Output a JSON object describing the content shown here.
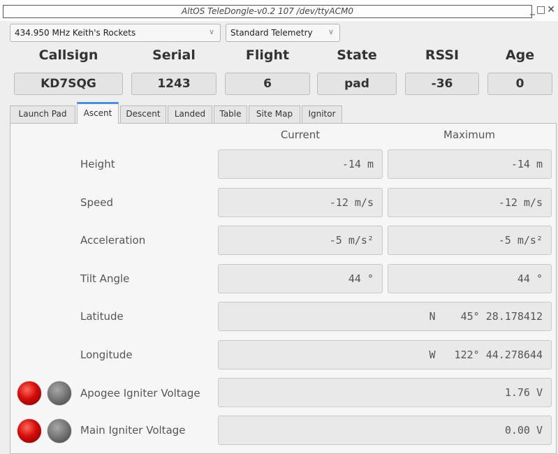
{
  "window": {
    "title": "AltOS TeleDongle-v0.2 107 /dev/ttyACM0",
    "buttons": [
      "_",
      "□",
      "✕"
    ]
  },
  "frequency_select": {
    "value": "434.950 MHz Keith's Rockets"
  },
  "telemetry_select": {
    "value": "Standard Telemetry"
  },
  "stats": [
    {
      "label": "Callsign",
      "value": "KD7SQG"
    },
    {
      "label": "Serial",
      "value": "1243"
    },
    {
      "label": "Flight",
      "value": "6"
    },
    {
      "label": "State",
      "value": "pad"
    },
    {
      "label": "RSSI",
      "value": "-36"
    },
    {
      "label": "Age",
      "value": "0"
    }
  ],
  "tabs": [
    {
      "label": "Launch Pad",
      "active": false
    },
    {
      "label": "Ascent",
      "active": true
    },
    {
      "label": "Descent",
      "active": false
    },
    {
      "label": "Landed",
      "active": false
    },
    {
      "label": "Table",
      "active": false
    },
    {
      "label": "Site Map",
      "active": false
    },
    {
      "label": "Ignitor",
      "active": false
    }
  ],
  "ascent": {
    "col_current": "Current",
    "col_maximum": "Maximum",
    "rows": [
      {
        "label": "Height",
        "current": "-14 m",
        "maximum": "-14 m"
      },
      {
        "label": "Speed",
        "current": "-12 m/s",
        "maximum": "-12 m/s"
      },
      {
        "label": "Acceleration",
        "current": "-5 m/s²",
        "maximum": "-5 m/s²"
      },
      {
        "label": "Tilt Angle",
        "current": "44 °",
        "maximum": "44 °"
      }
    ],
    "latitude": {
      "label": "Latitude",
      "value": "N    45° 28.178412"
    },
    "longitude": {
      "label": "Longitude",
      "value": "W   122° 44.278644"
    },
    "apogee": {
      "label": "Apogee Igniter Voltage",
      "value": "1.76 V",
      "led_colors": [
        "#d40b0b",
        "#6e6e6e"
      ]
    },
    "main": {
      "label": "Main Igniter Voltage",
      "value": "0.00 V",
      "led_colors": [
        "#d40b0b",
        "#6e6e6e"
      ]
    }
  }
}
